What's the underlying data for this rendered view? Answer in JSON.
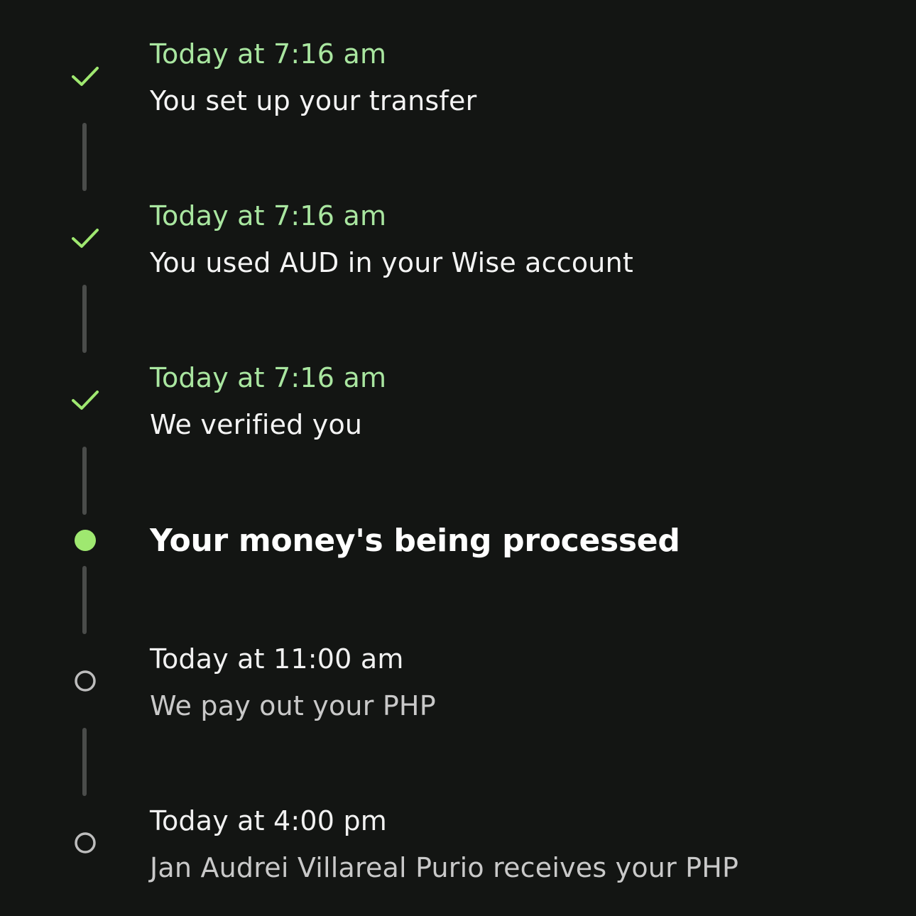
{
  "colors": {
    "background": "#131513",
    "accent_green": "#9fe870",
    "done_time_text": "#a9e6a0",
    "connector": "#4a4c4a",
    "future_marker": "#bdbdbd"
  },
  "timeline": {
    "steps": [
      {
        "status": "done",
        "icon": "check-icon",
        "time": "Today at 7:16 am",
        "description": "You set up your transfer"
      },
      {
        "status": "done",
        "icon": "check-icon",
        "time": "Today at 7:16 am",
        "description": "You used AUD in your Wise account"
      },
      {
        "status": "done",
        "icon": "check-icon",
        "time": "Today at 7:16 am",
        "description": "We verified you"
      },
      {
        "status": "current",
        "icon": "filled-dot-icon",
        "title": "Your money's being processed"
      },
      {
        "status": "upcoming",
        "icon": "empty-circle-icon",
        "time": "Today at 11:00 am",
        "description": "We pay out your PHP"
      },
      {
        "status": "upcoming",
        "icon": "empty-circle-icon",
        "time": "Today at 4:00 pm",
        "description": "Jan Audrei Villareal Purio receives your PHP"
      }
    ]
  }
}
